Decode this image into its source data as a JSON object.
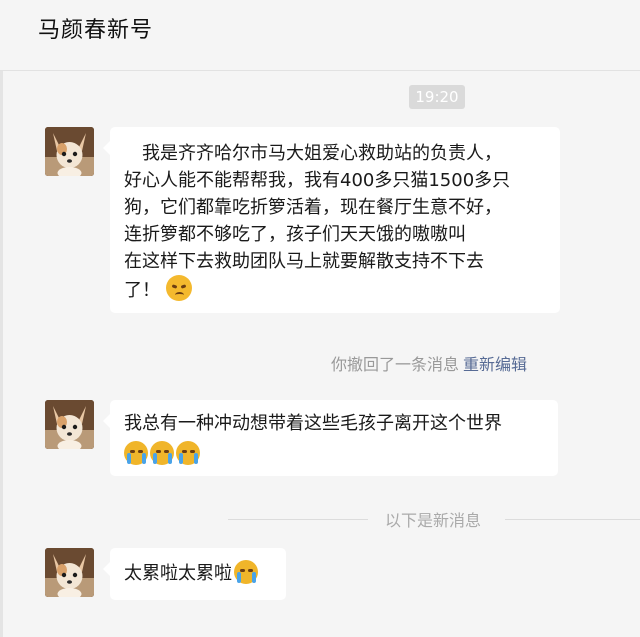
{
  "header": {
    "title": "马颜春新号"
  },
  "time_label": "19:20",
  "messages": [
    {
      "lines": [
        "　我是齐齐哈尔市马大姐爱心救助站的负责人，",
        "好心人能不能帮帮我，我有400多只猫1500多只",
        "狗，它们都靠吃折箩活着，现在餐厅生意不好，",
        "连折箩都不够吃了，孩子们天天饿的嗷嗷叫",
        "在这样下去救助团队马上就要解散支持不下去",
        "了！"
      ],
      "emoji": "angry-face-emoji"
    },
    {
      "lines": [
        "我总有一种冲动想带着这些毛孩子离开这个世界"
      ],
      "emoji": "crying-face-emoji x3"
    },
    {
      "lines": [
        "太累啦太累啦"
      ],
      "emoji": "crying-face-emoji"
    }
  ],
  "recall_notice": {
    "text": "你撤回了一条消息",
    "re_edit": "重新编辑"
  },
  "new_messages_divider": "以下是新消息",
  "colors": {
    "background": "#f5f5f5",
    "bubble": "#ffffff",
    "link": "#576b95",
    "time_chip": "#dadada"
  }
}
